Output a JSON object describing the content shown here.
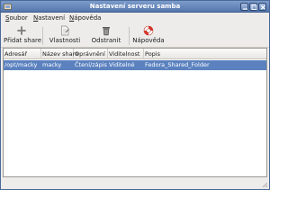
{
  "window": {
    "title": "Nastavení serveru samba"
  },
  "menubar": {
    "items": [
      "Soubor",
      "Nastavení",
      "Nápověda"
    ]
  },
  "toolbar": {
    "add_label": "Přidat share",
    "properties_label": "Vlastnosti",
    "delete_label": "Odstranit",
    "help_label": "Nápověda"
  },
  "table": {
    "columns": [
      "Adresář",
      "Název share",
      "Oprávnění",
      "Viditelnost",
      "Popis"
    ],
    "rows": [
      [
        "/opt/macky",
        "macky",
        "Čtení/zápis",
        "Viditelné",
        "Fedora_Shared_Folder"
      ]
    ]
  },
  "colors": {
    "titlebar": "#5577ad",
    "selection": "#5b82bf",
    "window_bg": "#edeceb"
  },
  "icons": {
    "window": "samba-app-icon",
    "add": "plus-icon",
    "properties": "document-properties-icon",
    "delete": "trash-icon",
    "help": "lifebuoy-icon"
  }
}
